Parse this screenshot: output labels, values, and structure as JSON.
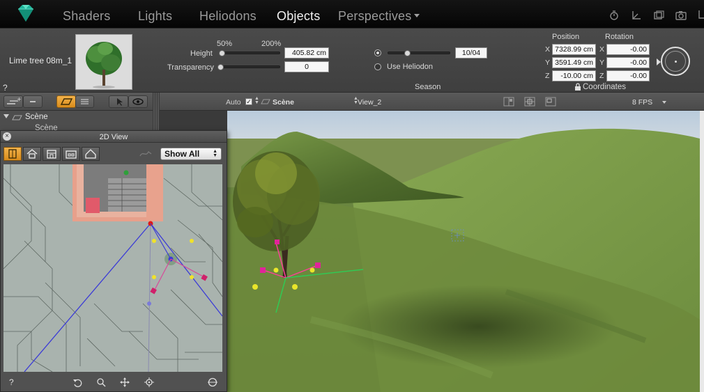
{
  "topbar": {
    "tabs": [
      {
        "label": "Shaders",
        "active": false
      },
      {
        "label": "Lights",
        "active": false
      },
      {
        "label": "Heliodons",
        "active": false
      },
      {
        "label": "Objects",
        "active": true
      },
      {
        "label": "Perspectives",
        "active": false
      }
    ],
    "icons": [
      "timer-icon",
      "axes-icon",
      "window-icon",
      "camera-icon"
    ]
  },
  "inspector": {
    "object_name": "Lime tree 08m_1",
    "help": "?",
    "height": {
      "label": "Height",
      "min_label": "50%",
      "max_label": "200%",
      "value": "405.82 cm",
      "slider_fraction": 0.02
    },
    "transparency": {
      "label": "Transparency",
      "value": "0",
      "slider_fraction": 0.0
    },
    "season": {
      "label": "Season",
      "date": "10/04",
      "slider_fraction": 0.3,
      "use_heliodon_label": "Use Heliodon",
      "use_heliodon_checked": false
    },
    "position": {
      "label": "Position",
      "x": "7328.99 cm",
      "y": "3591.49 cm",
      "z": "-10.00 cm"
    },
    "rotation": {
      "label": "Rotation",
      "x": "-0.00",
      "y": "-0.00",
      "z": "-0.00"
    },
    "axis_labels": {
      "x": "X",
      "y": "Y",
      "z": "Z"
    },
    "coordinates_label": "Coordinates"
  },
  "toolbar2": {
    "auto_label": "Auto",
    "auto_checked": true,
    "scene_label": "Scène",
    "view_label": "View_2",
    "fps_label": "8 FPS"
  },
  "scene_tree": {
    "root": "Scène",
    "child": "Scène"
  },
  "view2d": {
    "title": "2D View",
    "close": "×",
    "filter": "Show All",
    "help": "?"
  },
  "colors": {
    "accent": "#e89a2a",
    "camera_line": "#3b3bd6",
    "sky": "#c9d7e3",
    "grass": "#6e8a3e"
  }
}
